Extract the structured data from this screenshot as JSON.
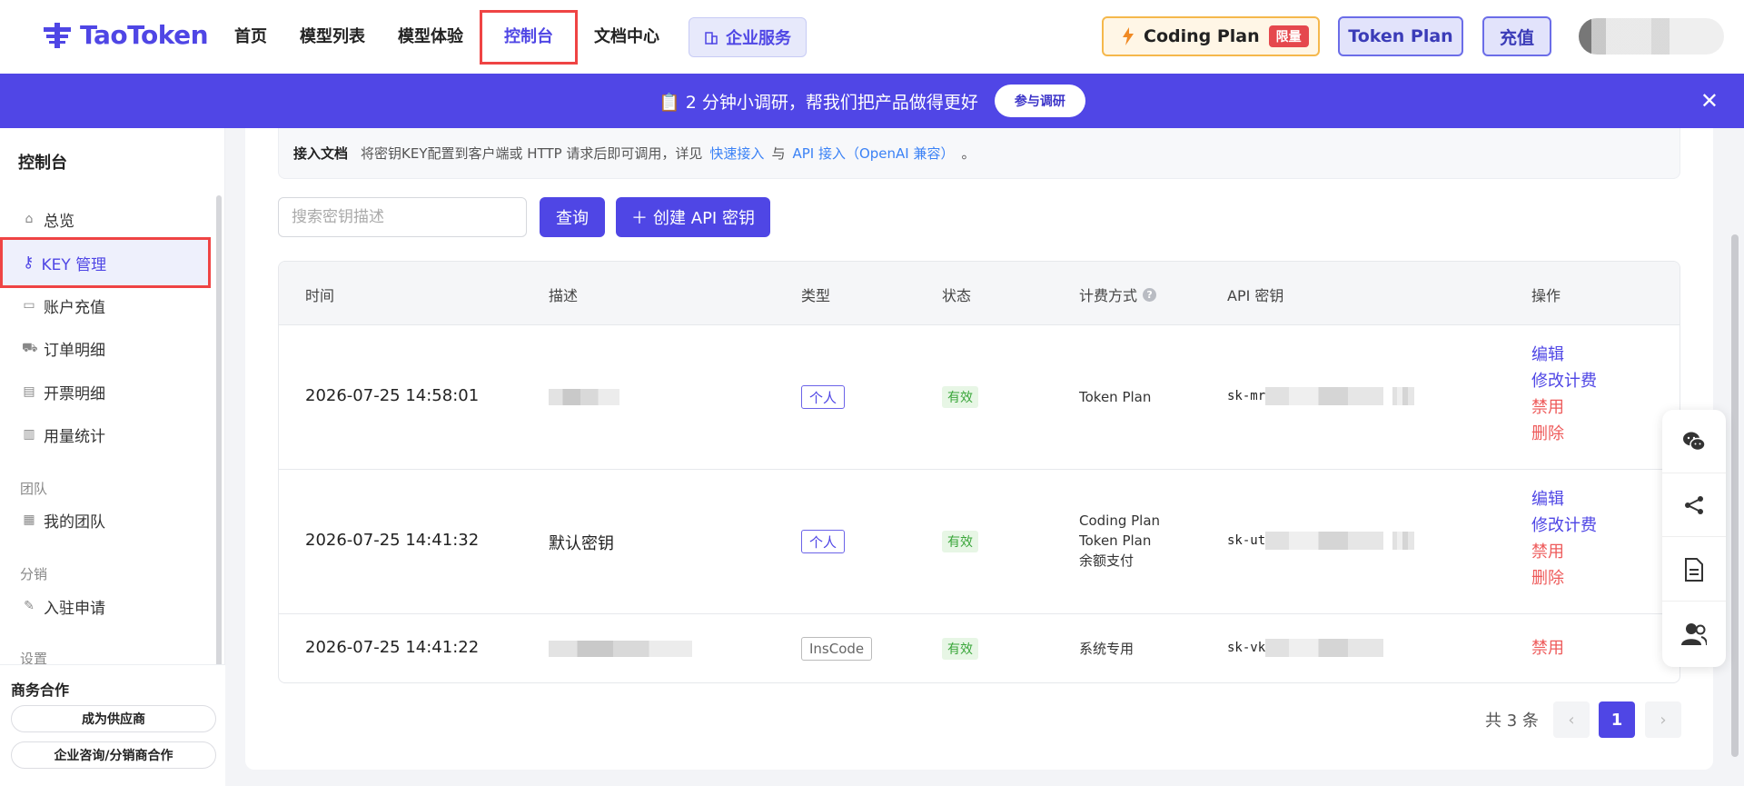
{
  "header": {
    "logo": "TaoToken",
    "nav": [
      "首页",
      "模型列表",
      "模型体验",
      "控制台",
      "文档中心"
    ],
    "enterprise": "企业服务",
    "coding_plan": "Coding Plan",
    "limited": "限量",
    "token_plan": "Token Plan",
    "recharge": "充值"
  },
  "banner": {
    "text": "📋 2 分钟小调研，帮我们把产品做得更好",
    "button": "参与调研",
    "close": "✕"
  },
  "sidebar": {
    "title": "控制台",
    "items": [
      {
        "label": "总览",
        "icon": "shop-icon"
      },
      {
        "label": "KEY 管理",
        "icon": "key-icon"
      },
      {
        "label": "账户充值",
        "icon": "wallet-icon"
      },
      {
        "label": "订单明细",
        "icon": "cart-icon"
      },
      {
        "label": "开票明细",
        "icon": "invoice-icon"
      },
      {
        "label": "用量统计",
        "icon": "stats-icon"
      }
    ],
    "group_team": "团队",
    "team_item": "我的团队",
    "group_distribution": "分销",
    "distribution_item": "入驻申请",
    "group_settings": "设置",
    "footer_title": "商务合作",
    "footer_btn1": "成为供应商",
    "footer_btn2": "企业咨询/分销商合作"
  },
  "main": {
    "doc_label": "接入文档",
    "doc_text": "将密钥KEY配置到客户端或 HTTP 请求后即可调用，详见",
    "doc_link1": "快速接入",
    "doc_and": "与",
    "doc_link2": "API 接入（OpenAI 兼容）",
    "doc_end": "。",
    "search_placeholder": "搜索密钥描述",
    "query_btn": "查询",
    "create_btn": "创建 API 密钥",
    "columns": [
      "时间",
      "描述",
      "类型",
      "状态",
      "计费方式",
      "API 密钥",
      "操作"
    ],
    "rows": [
      {
        "time": "2026-07-25 14:58:01",
        "desc": "",
        "type": "个人",
        "status": "有效",
        "billing": [
          "Token Plan"
        ],
        "key_prefix": "sk-mr",
        "actions": [
          "编辑",
          "修改计费",
          "禁用",
          "删除"
        ]
      },
      {
        "time": "2026-07-25 14:41:32",
        "desc": "默认密钥",
        "type": "个人",
        "status": "有效",
        "billing": [
          "Coding Plan",
          "Token Plan",
          "余额支付"
        ],
        "key_prefix": "sk-ut",
        "actions": [
          "编辑",
          "修改计费",
          "禁用",
          "删除"
        ]
      },
      {
        "time": "2026-07-25 14:41:22",
        "desc": "",
        "type": "InsCode",
        "status": "有效",
        "billing": [
          "系统专用"
        ],
        "key_prefix": "sk-vk",
        "actions": [
          "禁用"
        ]
      }
    ],
    "total": "共 3 条",
    "page": "1",
    "prev": "‹",
    "next": "›"
  },
  "float_panel": [
    "wechat-icon",
    "share-icon",
    "document-icon",
    "contact-icon"
  ],
  "colors": {
    "accent": "#4f46e5",
    "banner": "#5046e6",
    "danger": "#ee5a5a",
    "valid": "#3aa63a"
  }
}
